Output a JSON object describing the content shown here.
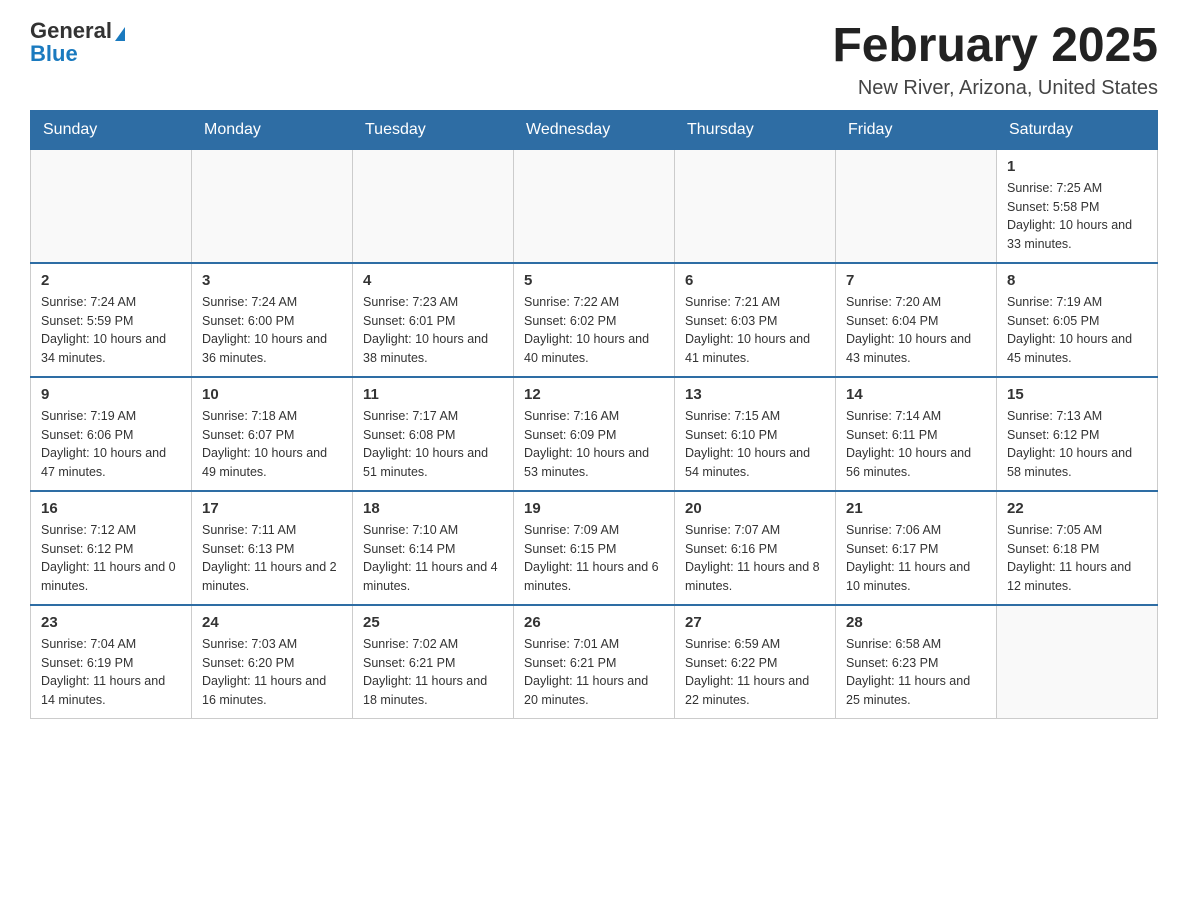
{
  "header": {
    "logo_general": "General",
    "logo_blue": "Blue",
    "month_title": "February 2025",
    "subtitle": "New River, Arizona, United States"
  },
  "days_of_week": [
    "Sunday",
    "Monday",
    "Tuesday",
    "Wednesday",
    "Thursday",
    "Friday",
    "Saturday"
  ],
  "weeks": [
    [
      {
        "day": "",
        "info": ""
      },
      {
        "day": "",
        "info": ""
      },
      {
        "day": "",
        "info": ""
      },
      {
        "day": "",
        "info": ""
      },
      {
        "day": "",
        "info": ""
      },
      {
        "day": "",
        "info": ""
      },
      {
        "day": "1",
        "info": "Sunrise: 7:25 AM\nSunset: 5:58 PM\nDaylight: 10 hours\nand 33 minutes."
      }
    ],
    [
      {
        "day": "2",
        "info": "Sunrise: 7:24 AM\nSunset: 5:59 PM\nDaylight: 10 hours\nand 34 minutes."
      },
      {
        "day": "3",
        "info": "Sunrise: 7:24 AM\nSunset: 6:00 PM\nDaylight: 10 hours\nand 36 minutes."
      },
      {
        "day": "4",
        "info": "Sunrise: 7:23 AM\nSunset: 6:01 PM\nDaylight: 10 hours\nand 38 minutes."
      },
      {
        "day": "5",
        "info": "Sunrise: 7:22 AM\nSunset: 6:02 PM\nDaylight: 10 hours\nand 40 minutes."
      },
      {
        "day": "6",
        "info": "Sunrise: 7:21 AM\nSunset: 6:03 PM\nDaylight: 10 hours\nand 41 minutes."
      },
      {
        "day": "7",
        "info": "Sunrise: 7:20 AM\nSunset: 6:04 PM\nDaylight: 10 hours\nand 43 minutes."
      },
      {
        "day": "8",
        "info": "Sunrise: 7:19 AM\nSunset: 6:05 PM\nDaylight: 10 hours\nand 45 minutes."
      }
    ],
    [
      {
        "day": "9",
        "info": "Sunrise: 7:19 AM\nSunset: 6:06 PM\nDaylight: 10 hours\nand 47 minutes."
      },
      {
        "day": "10",
        "info": "Sunrise: 7:18 AM\nSunset: 6:07 PM\nDaylight: 10 hours\nand 49 minutes."
      },
      {
        "day": "11",
        "info": "Sunrise: 7:17 AM\nSunset: 6:08 PM\nDaylight: 10 hours\nand 51 minutes."
      },
      {
        "day": "12",
        "info": "Sunrise: 7:16 AM\nSunset: 6:09 PM\nDaylight: 10 hours\nand 53 minutes."
      },
      {
        "day": "13",
        "info": "Sunrise: 7:15 AM\nSunset: 6:10 PM\nDaylight: 10 hours\nand 54 minutes."
      },
      {
        "day": "14",
        "info": "Sunrise: 7:14 AM\nSunset: 6:11 PM\nDaylight: 10 hours\nand 56 minutes."
      },
      {
        "day": "15",
        "info": "Sunrise: 7:13 AM\nSunset: 6:12 PM\nDaylight: 10 hours\nand 58 minutes."
      }
    ],
    [
      {
        "day": "16",
        "info": "Sunrise: 7:12 AM\nSunset: 6:12 PM\nDaylight: 11 hours\nand 0 minutes."
      },
      {
        "day": "17",
        "info": "Sunrise: 7:11 AM\nSunset: 6:13 PM\nDaylight: 11 hours\nand 2 minutes."
      },
      {
        "day": "18",
        "info": "Sunrise: 7:10 AM\nSunset: 6:14 PM\nDaylight: 11 hours\nand 4 minutes."
      },
      {
        "day": "19",
        "info": "Sunrise: 7:09 AM\nSunset: 6:15 PM\nDaylight: 11 hours\nand 6 minutes."
      },
      {
        "day": "20",
        "info": "Sunrise: 7:07 AM\nSunset: 6:16 PM\nDaylight: 11 hours\nand 8 minutes."
      },
      {
        "day": "21",
        "info": "Sunrise: 7:06 AM\nSunset: 6:17 PM\nDaylight: 11 hours\nand 10 minutes."
      },
      {
        "day": "22",
        "info": "Sunrise: 7:05 AM\nSunset: 6:18 PM\nDaylight: 11 hours\nand 12 minutes."
      }
    ],
    [
      {
        "day": "23",
        "info": "Sunrise: 7:04 AM\nSunset: 6:19 PM\nDaylight: 11 hours\nand 14 minutes."
      },
      {
        "day": "24",
        "info": "Sunrise: 7:03 AM\nSunset: 6:20 PM\nDaylight: 11 hours\nand 16 minutes."
      },
      {
        "day": "25",
        "info": "Sunrise: 7:02 AM\nSunset: 6:21 PM\nDaylight: 11 hours\nand 18 minutes."
      },
      {
        "day": "26",
        "info": "Sunrise: 7:01 AM\nSunset: 6:21 PM\nDaylight: 11 hours\nand 20 minutes."
      },
      {
        "day": "27",
        "info": "Sunrise: 6:59 AM\nSunset: 6:22 PM\nDaylight: 11 hours\nand 22 minutes."
      },
      {
        "day": "28",
        "info": "Sunrise: 6:58 AM\nSunset: 6:23 PM\nDaylight: 11 hours\nand 25 minutes."
      },
      {
        "day": "",
        "info": ""
      }
    ]
  ]
}
